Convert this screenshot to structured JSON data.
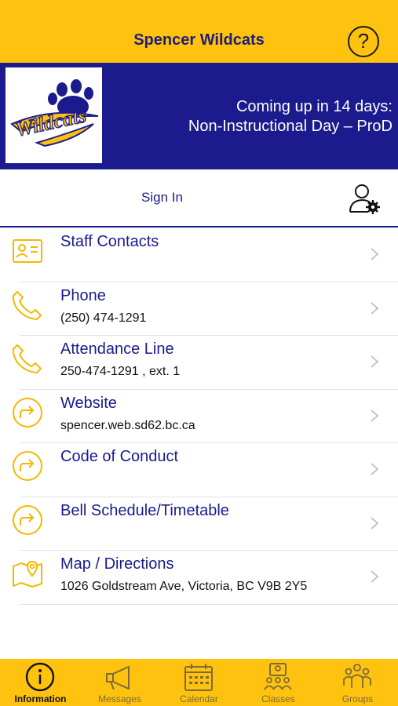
{
  "header": {
    "title": "Spencer Wildcats",
    "help_icon": "help-circle-icon"
  },
  "banner": {
    "logo_text": "Wildcats",
    "line1": "Coming up in 14 days:",
    "line2": "Non-Instructional Day – ProD"
  },
  "signin": {
    "label": "Sign In",
    "icon": "user-settings-icon"
  },
  "items": [
    {
      "label": "Staff Contacts",
      "sub": "",
      "icon": "contact-card-icon"
    },
    {
      "label": "Phone",
      "sub": "(250) 474-1291",
      "icon": "phone-icon"
    },
    {
      "label": "Attendance Line",
      "sub": "250-474-1291 , ext. 1",
      "icon": "phone-icon"
    },
    {
      "label": "Website",
      "sub": "spencer.web.sd62.bc.ca",
      "icon": "share-arrow-icon"
    },
    {
      "label": "Code of Conduct",
      "sub": "",
      "icon": "share-arrow-icon"
    },
    {
      "label": "Bell Schedule/Timetable",
      "sub": "",
      "icon": "share-arrow-icon"
    },
    {
      "label": "Map / Directions",
      "sub": "1026 Goldstream Ave, Victoria, BC V9B 2Y5",
      "icon": "map-pin-icon"
    }
  ],
  "tabs": [
    {
      "label": "Information",
      "active": true
    },
    {
      "label": "Messages",
      "active": false
    },
    {
      "label": "Calendar",
      "active": false
    },
    {
      "label": "Classes",
      "active": false
    },
    {
      "label": "Groups",
      "active": false
    }
  ],
  "colors": {
    "gold": "#FFC20E",
    "navy": "#1B1B8E",
    "title_navy": "#1E1E78"
  }
}
